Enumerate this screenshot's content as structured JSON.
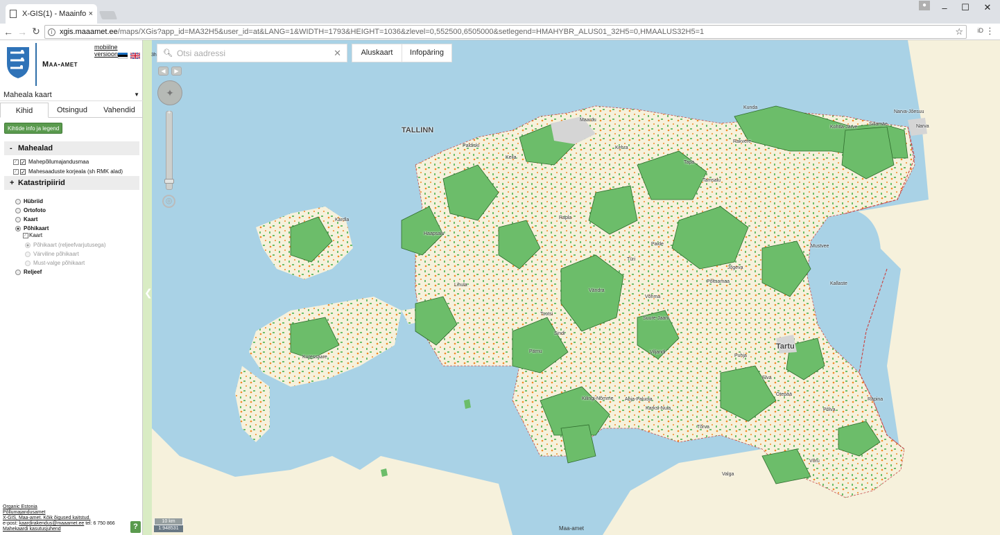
{
  "browser": {
    "tab_title": "X-GIS(1) - Maainfo",
    "tab_close": "×",
    "url_host": "xgis.maaamet.ee",
    "url_rest": "/maps/XGis?app_id=MA32H5&user_id=at&LANG=1&WIDTH=1793&HEIGHT=1036&zlevel=0,552500,6505000&setlegend=HMAHYBR_ALUS01_32H5=0,HMAALUS32H5=1",
    "ext_label": "iD",
    "icons": [
      "back-icon",
      "forward-icon",
      "reload-icon",
      "info-icon",
      "star-icon",
      "menu-icon",
      "user-icon"
    ]
  },
  "sidebar": {
    "logo_text": "Maa-amet",
    "mobile_link": "mobiilne versioon",
    "map_select": "Maheala kaart",
    "tabs": [
      "Kihid",
      "Otsingud",
      "Vahendid"
    ],
    "legend_button": "Kihtide info ja legend",
    "groups": {
      "mahealad": {
        "sign": "-",
        "label": "Mahealad"
      },
      "katastri": {
        "sign": "+",
        "label": "Katastripiirid"
      }
    },
    "layers": [
      "Mahepõllumajandusmaa",
      "Mahesaaduste korjeala (sh RMK alad)"
    ],
    "base_maps": [
      "Hübriid",
      "Ortofoto",
      "Kaart",
      "Põhikaart",
      "Reljeef"
    ],
    "base_selected": "Põhikaart",
    "kaart_sub_label": "Kaart",
    "sub_options": [
      "Põhikaart (reljeefvarjutusega)",
      "Värviline põhikaart",
      "Must-valge põhikaart"
    ],
    "footer": {
      "line1": "Organic Estonia",
      "line2": "Põllumajandusamet",
      "line3": "X-GIS, Maa-amet. Kõik õigused kaitstud.",
      "line4_prefix": "e-post: ",
      "line4_email": "kaardirakendus@maaamet.ee",
      "line4_tel": " tel: 6 750 866",
      "line5": "Mahekaardi kasutusjuhend"
    },
    "help_label": "?"
  },
  "map": {
    "search_placeholder": "Otsi aadressi",
    "btn_base": "Aluskaart",
    "btn_info": "Infopäring",
    "cut_label": "3h",
    "scale_label": "10 km",
    "scale_ratio": "1:948531",
    "attribution": "Maa-amet",
    "places": {
      "tallinn": "TALLINN",
      "narva": "Narva",
      "narva_joesuu": "Narva-Jõesuu",
      "sillamae": "Sillamäe",
      "kohtla_jarve": "Kohtla-Järve",
      "kunda": "Kunda",
      "rakvere": "Rakvere",
      "tapa": "Tapa",
      "tamsalu": "Tamsalu",
      "kehra": "Kehra",
      "paldiski": "Paldiski",
      "keila": "Keila",
      "maardu": "Maardu",
      "haapsalu": "Haapsalu",
      "kardla": "Kärdla",
      "rapla": "Rapla",
      "turi": "Türi",
      "paide": "Paide",
      "jogeva": "Jõgeva",
      "mustvee": "Mustvee",
      "kallaste": "Kallaste",
      "tartu": "Tartu",
      "elva": "Elva",
      "otepaa": "Otepää",
      "polva": "Põlva",
      "rapina": "Räpina",
      "voru": "Võru",
      "valga": "Valga",
      "torva": "Tõrva",
      "karksi": "Karksi-Nuia",
      "abja": "Abja-Paluoja",
      "kilingi": "Kilingi-Nõmme",
      "viljandi": "Viljandi",
      "suure_jaani": "Suure-Jaani",
      "vohma": "Võhma",
      "parnu": "Pärnu",
      "lihula": "Lihula",
      "kuressaare": "Kuressaare",
      "puhja": "Puhja",
      "sindi": "Sindi",
      "vandra": "Vändra",
      "polva2": "Põltsamaa",
      "tootsi": "Tootsi"
    }
  },
  "colors": {
    "sea": "#a9d2e6",
    "land": "#f6f1dc",
    "green": "#6cbd6a",
    "green_edge": "#2e6b2c",
    "orange": "#f08a24",
    "accent_btn": "#5a9a4e"
  }
}
